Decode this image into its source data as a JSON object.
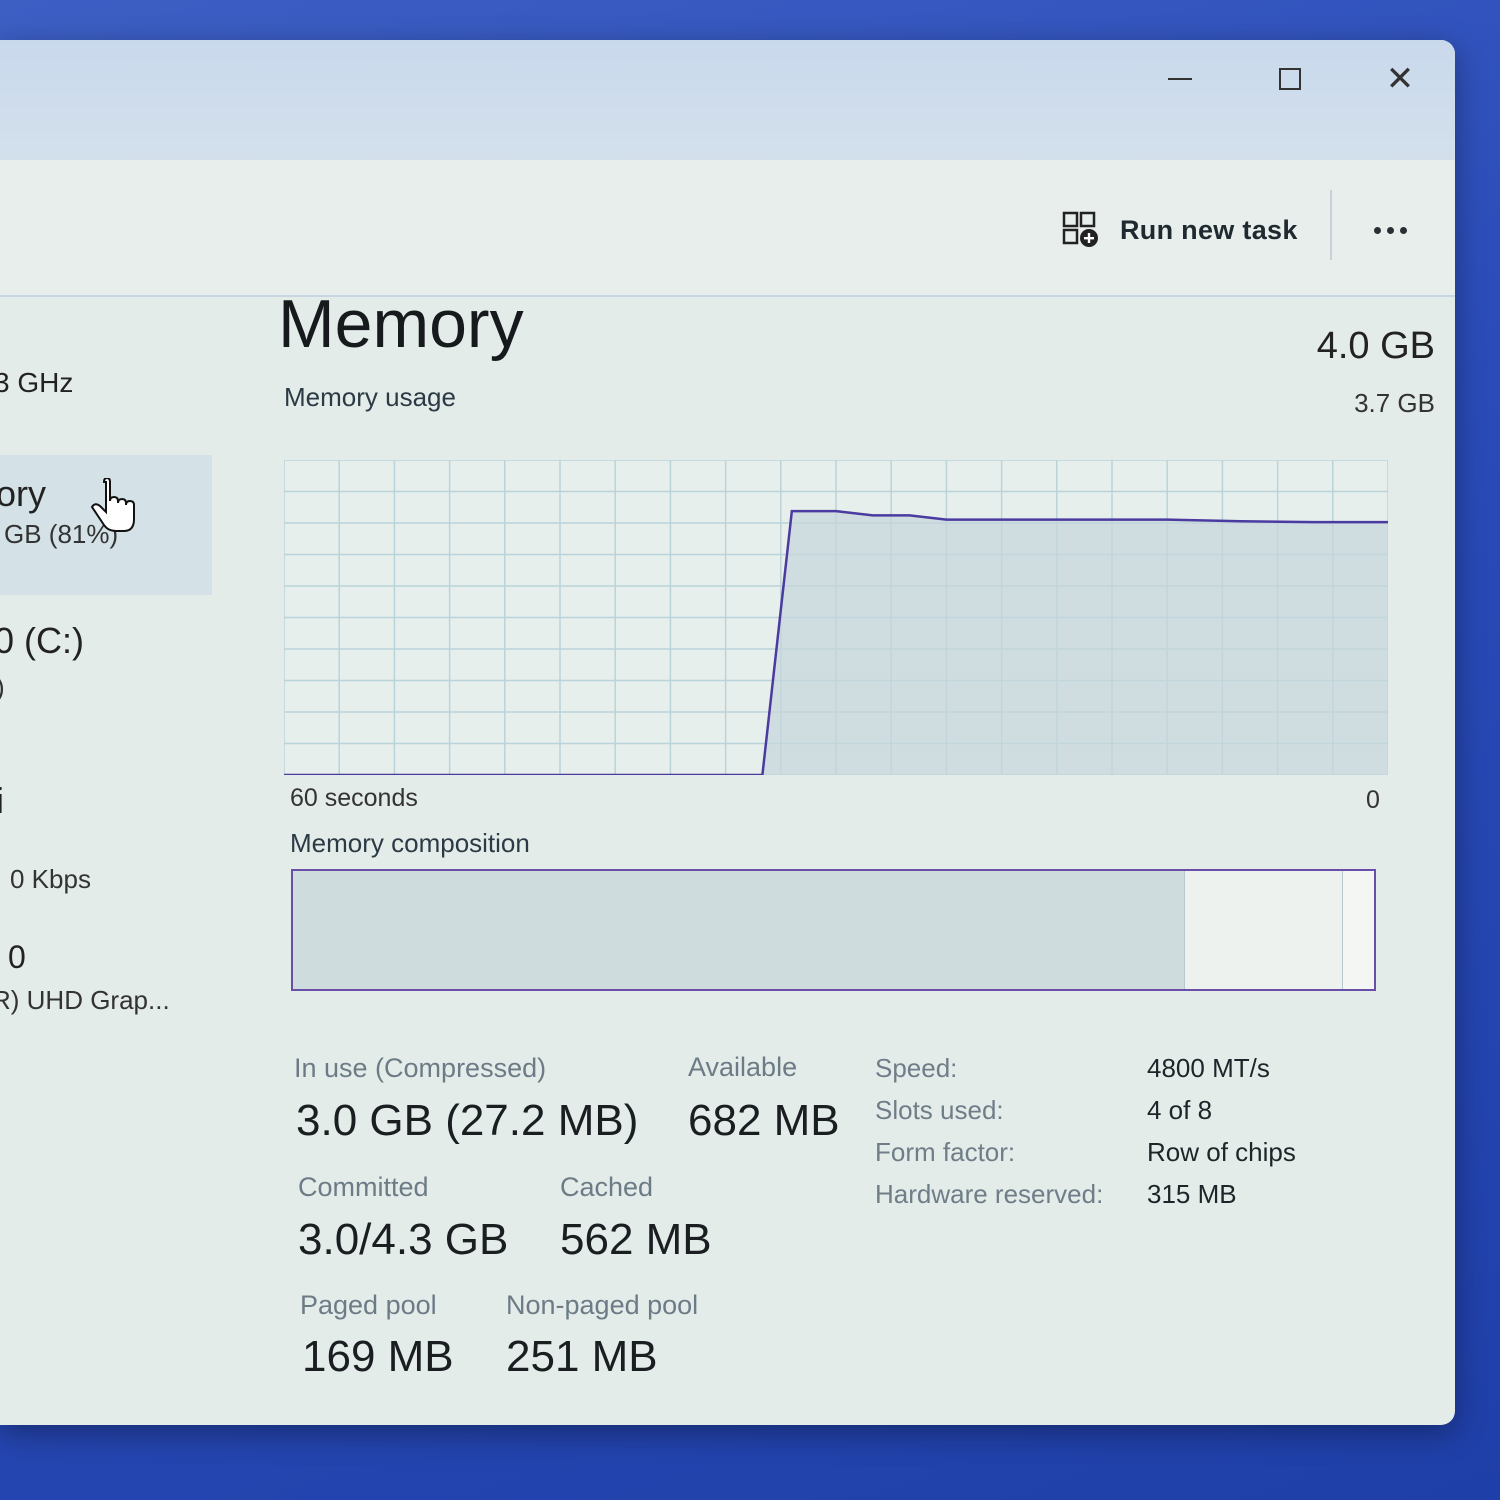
{
  "toolbar": {
    "run_task_label": "Run new task"
  },
  "sidebar": {
    "items": [
      {
        "primary": "3 GHz",
        "secondary": ""
      },
      {
        "primary": "ory",
        "secondary": "GB (81%)"
      },
      {
        "primary": "0 (C:)",
        "secondary": ")"
      },
      {
        "primary": "i",
        "secondary": "0 Kbps"
      },
      {
        "primary": "0",
        "secondary": "R) UHD Grap..."
      }
    ]
  },
  "main": {
    "title": "Memory",
    "total": "4.0 GB",
    "usage_label": "Memory usage",
    "usage_max": "3.7 GB",
    "axis_left": "60 seconds",
    "axis_right": "0",
    "composition_label": "Memory composition",
    "stats": {
      "in_use_label": "In use (Compressed)",
      "in_use_value": "3.0 GB (27.2 MB)",
      "available_label": "Available",
      "available_value": "682 MB",
      "committed_label": "Committed",
      "committed_value": "3.0/4.3 GB",
      "cached_label": "Cached",
      "cached_value": "562 MB",
      "paged_label": "Paged pool",
      "paged_value": "169 MB",
      "nonpaged_label": "Non-paged pool",
      "nonpaged_value": "251 MB"
    },
    "specs": [
      {
        "label": "Speed:",
        "value": "4800 MT/s"
      },
      {
        "label": "Slots used:",
        "value": "4 of 8"
      },
      {
        "label": "Form factor:",
        "value": "Row of chips"
      },
      {
        "label": "Hardware reserved:",
        "value": "315 MB"
      }
    ]
  },
  "chart_data": {
    "type": "area",
    "title": "Memory usage",
    "xlabel": "60 seconds",
    "ylabel": "",
    "x_range": [
      60,
      0
    ],
    "ylim": [
      0,
      3.7
    ],
    "grid": true,
    "series": [
      {
        "values_x": [
          60,
          34,
          32.4,
          30,
          28,
          26,
          24,
          20,
          16,
          12,
          8,
          4,
          0
        ],
        "values_y": [
          0,
          0,
          3.1,
          3.1,
          3.05,
          3.05,
          3.0,
          3.0,
          3.0,
          3.0,
          2.98,
          2.97,
          2.97
        ]
      }
    ]
  },
  "composition": {
    "in_use_pct": 82.5,
    "modified_pct": 0,
    "standby_pct": 14.6,
    "free_pct": 2.9
  },
  "colors": {
    "chart_line": "#4b3aa0",
    "chart_fill": "#c6d6dc",
    "grid": "#b9d3da",
    "frame": "#6a4fa8"
  }
}
